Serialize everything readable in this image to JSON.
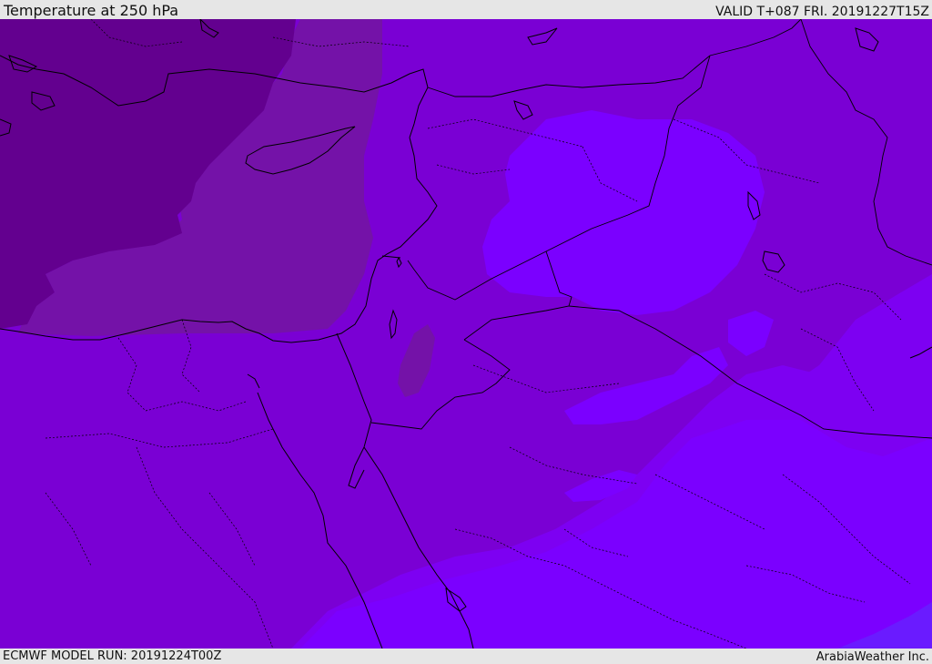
{
  "header": {
    "title": "Temperature at 250 hPa",
    "valid": "VALID T+087 FRI. 20191227T15Z"
  },
  "footer": {
    "model_run": "ECMWF MODEL RUN: 20191224T00Z",
    "credit": "ArabiaWeather Inc."
  },
  "palette": {
    "darkest": "#63008f",
    "dark": "#7412a8",
    "mid": "#7a00d4",
    "bright": "#7d00f2",
    "brightest": "#7b00ff",
    "corner": "#6a1bff",
    "coastline": "#000000"
  }
}
